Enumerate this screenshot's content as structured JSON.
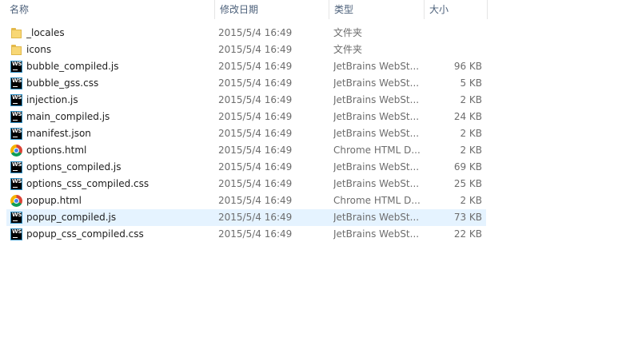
{
  "columns": {
    "name": "名称",
    "date": "修改日期",
    "type": "类型",
    "size": "大小",
    "sort_indicator": "^"
  },
  "files": [
    {
      "name": "_locales",
      "date": "2015/5/4 16:49",
      "type": "文件夹",
      "size": "",
      "icon": "folder-icon",
      "selected": false
    },
    {
      "name": "icons",
      "date": "2015/5/4 16:49",
      "type": "文件夹",
      "size": "",
      "icon": "folder-icon",
      "selected": false
    },
    {
      "name": "bubble_compiled.js",
      "date": "2015/5/4 16:49",
      "type": "JetBrains WebSt...",
      "size": "96 KB",
      "icon": "webstorm-icon",
      "selected": false
    },
    {
      "name": "bubble_gss.css",
      "date": "2015/5/4 16:49",
      "type": "JetBrains WebSt...",
      "size": "5 KB",
      "icon": "webstorm-icon",
      "selected": false
    },
    {
      "name": "injection.js",
      "date": "2015/5/4 16:49",
      "type": "JetBrains WebSt...",
      "size": "2 KB",
      "icon": "webstorm-icon",
      "selected": false
    },
    {
      "name": "main_compiled.js",
      "date": "2015/5/4 16:49",
      "type": "JetBrains WebSt...",
      "size": "24 KB",
      "icon": "webstorm-icon",
      "selected": false
    },
    {
      "name": "manifest.json",
      "date": "2015/5/4 16:49",
      "type": "JetBrains WebSt...",
      "size": "2 KB",
      "icon": "webstorm-icon",
      "selected": false
    },
    {
      "name": "options.html",
      "date": "2015/5/4 16:49",
      "type": "Chrome HTML D...",
      "size": "2 KB",
      "icon": "chrome-icon",
      "selected": false
    },
    {
      "name": "options_compiled.js",
      "date": "2015/5/4 16:49",
      "type": "JetBrains WebSt...",
      "size": "69 KB",
      "icon": "webstorm-icon",
      "selected": false
    },
    {
      "name": "options_css_compiled.css",
      "date": "2015/5/4 16:49",
      "type": "JetBrains WebSt...",
      "size": "25 KB",
      "icon": "webstorm-icon",
      "selected": false
    },
    {
      "name": "popup.html",
      "date": "2015/5/4 16:49",
      "type": "Chrome HTML D...",
      "size": "2 KB",
      "icon": "chrome-icon",
      "selected": false
    },
    {
      "name": "popup_compiled.js",
      "date": "2015/5/4 16:49",
      "type": "JetBrains WebSt...",
      "size": "73 KB",
      "icon": "webstorm-icon",
      "selected": true
    },
    {
      "name": "popup_css_compiled.css",
      "date": "2015/5/4 16:49",
      "type": "JetBrains WebSt...",
      "size": "22 KB",
      "icon": "webstorm-icon",
      "selected": false
    }
  ],
  "colors": {
    "selected_row": "#e5f3ff",
    "header_text": "#4c607a",
    "secondary_text": "#6d6d6d"
  }
}
